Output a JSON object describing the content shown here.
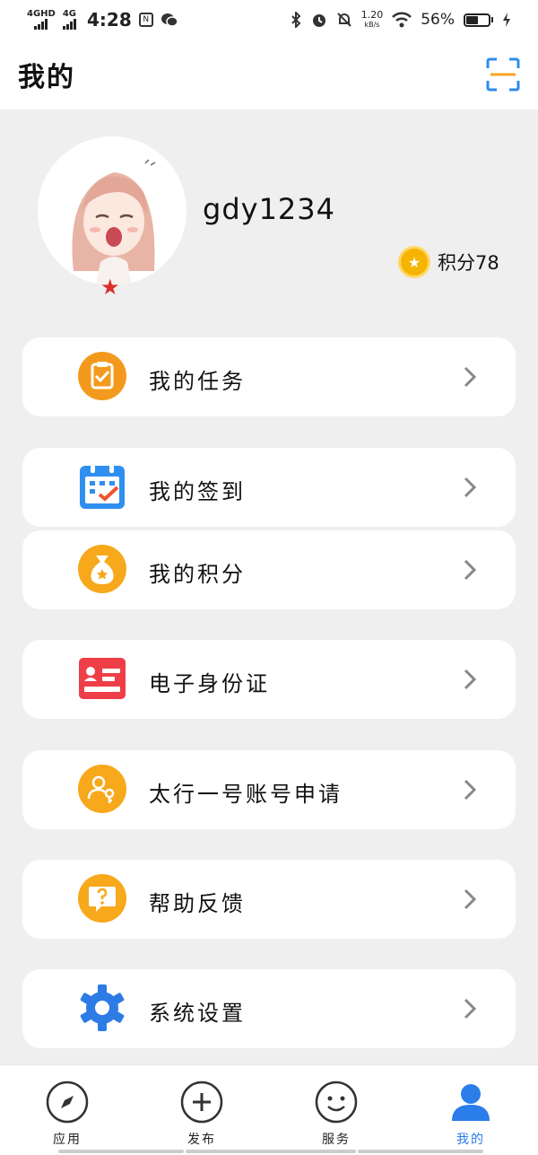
{
  "status_bar": {
    "net1": "4GHD",
    "net2": "4G",
    "time": "4:28",
    "speed_value": "1.20",
    "speed_unit": "kB/s",
    "battery": "56%"
  },
  "header": {
    "title": "我的",
    "scan_icon": "scan-icon"
  },
  "profile": {
    "username": "gdy1234",
    "points_label": "积分78",
    "points": 78
  },
  "menu": [
    {
      "label": "我的任务",
      "icon": "task-clipboard-icon",
      "color": "#f39a1e"
    },
    {
      "label": "我的签到",
      "icon": "calendar-checkin-icon",
      "color": "#2f8ff0"
    },
    {
      "label": "我的积分",
      "icon": "points-bag-icon",
      "color": "#f7a81b"
    },
    {
      "label": "电子身份证",
      "icon": "id-card-icon",
      "color": "#ee3e48"
    },
    {
      "label": "太行一号账号申请",
      "icon": "account-key-icon",
      "color": "#f7a81b"
    },
    {
      "label": "帮助反馈",
      "icon": "help-question-icon",
      "color": "#f7a81b"
    },
    {
      "label": "系统设置",
      "icon": "gear-icon",
      "color": "#2d7be5"
    }
  ],
  "bottom_nav": [
    {
      "label": "应用",
      "icon": "compass-icon"
    },
    {
      "label": "发布",
      "icon": "plus-circle-icon"
    },
    {
      "label": "服务",
      "icon": "smile-icon"
    },
    {
      "label": "我的",
      "icon": "person-icon",
      "active": true
    }
  ],
  "colors": {
    "accent": "#2b7de9",
    "background": "#efefef"
  }
}
